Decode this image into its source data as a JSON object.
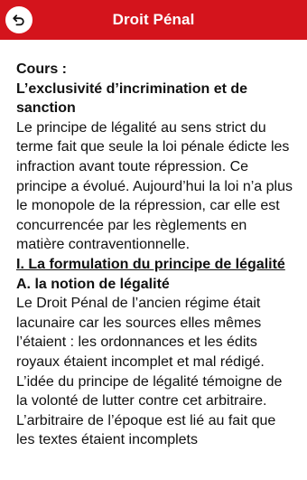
{
  "header": {
    "title": "Droit Pénal",
    "back_icon": "back-arrow-icon",
    "background_color": "#d4141c"
  },
  "content": {
    "cours_label": "Cours :",
    "section_title": "L’exclusivité d’incrimination et de sanction",
    "paragraph_1": "Le principe de légalité au sens strict du terme fait que seule la loi pénale édicte les infraction avant toute répression. Ce principe a évolué. Aujourd’hui la loi n’a plus le monopole de la répression, car elle est concurrencée par les règlements en matière contraventionnelle.",
    "part_1_title": "I. La formulation du principe de légalité",
    "subpart_a_title": "A. la notion de légalité",
    "paragraph_2": "Le Droit Pénal de l’ancien régime était lacunaire car les sources elles mêmes l’étaient : les ordonnances et les édits royaux étaient incomplet et mal rédigé. L’idée du principe de légalité témoigne de la volonté de lutter contre cet arbitraire. L’arbitraire de l’époque est lié au fait que les textes étaient incomplets"
  }
}
